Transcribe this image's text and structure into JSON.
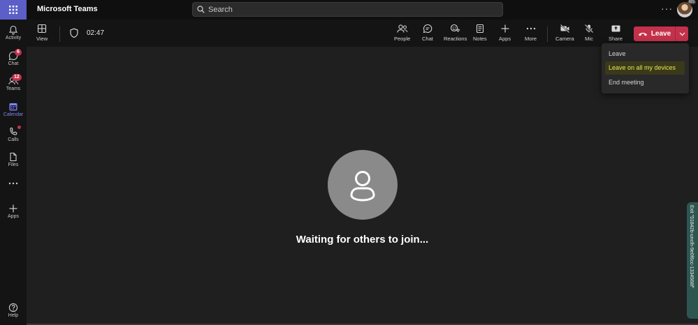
{
  "app": {
    "title": "Microsoft Teams",
    "avatar_status": "BS"
  },
  "search": {
    "placeholder": "Search"
  },
  "rail": {
    "items": [
      {
        "label": "Activity",
        "icon": "bell-icon"
      },
      {
        "label": "Chat",
        "icon": "chat-icon",
        "badge": "6"
      },
      {
        "label": "Teams",
        "icon": "teams-icon",
        "badge": "12"
      },
      {
        "label": "Calendar",
        "icon": "calendar-icon"
      },
      {
        "label": "Calls",
        "icon": "phone-icon"
      },
      {
        "label": "Files",
        "icon": "file-icon"
      },
      {
        "label": "",
        "icon": "more-icon"
      },
      {
        "label": "Apps",
        "icon": "plus-icon"
      },
      {
        "label": "Help",
        "icon": "help-icon"
      }
    ]
  },
  "toolbar": {
    "view_label": "View",
    "timer": "02:47",
    "people_label": "People",
    "chat_label": "Chat",
    "reactions_label": "Reactions",
    "notes_label": "Notes",
    "apps_label": "Apps",
    "more_label": "More",
    "camera_label": "Camera",
    "mic_label": "Mic",
    "share_label": "Share",
    "leave_label": "Leave"
  },
  "leave_menu": {
    "items": [
      "Leave",
      "Leave on all my devices",
      "End meeting"
    ],
    "highlighted": "Leave on all my devices",
    "highlight_color": "#e6e65a"
  },
  "stage": {
    "message": "Waiting for others to join..."
  },
  "side_tab": {
    "label": "Exit \"51842b-unclh-9e0f6cc-1334568f\""
  },
  "colors": {
    "accent": "#5b5fc7",
    "leave": "#c4314b",
    "badge": "#c4314b"
  }
}
